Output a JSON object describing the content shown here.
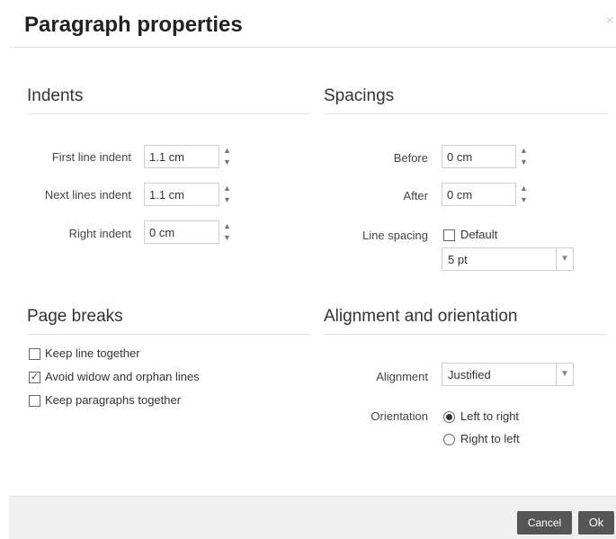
{
  "dialog": {
    "title": "Paragraph properties",
    "close_glyph": "×"
  },
  "indents": {
    "heading": "Indents",
    "first_line": {
      "label": "First line indent",
      "value": "1.1 cm"
    },
    "next_lines": {
      "label": "Next lines indent",
      "value": "1.1 cm"
    },
    "right": {
      "label": "Right indent",
      "value": "0 cm"
    }
  },
  "spacings": {
    "heading": "Spacings",
    "before": {
      "label": "Before",
      "value": "0 cm"
    },
    "after": {
      "label": "After",
      "value": "0 cm"
    },
    "line_spacing": {
      "label": "Line spacing",
      "default_label": "Default",
      "default_checked": false,
      "value": "5 pt"
    }
  },
  "page_breaks": {
    "heading": "Page breaks",
    "options": [
      {
        "label": "Keep line together",
        "checked": false
      },
      {
        "label": "Avoid widow and orphan lines",
        "checked": true
      },
      {
        "label": "Keep paragraphs together",
        "checked": false
      }
    ]
  },
  "alignment": {
    "heading": "Alignment and orientation",
    "alignment_label": "Alignment",
    "alignment_value": "Justified",
    "orientation_label": "Orientation",
    "orientations": [
      {
        "label": "Left to right",
        "selected": true
      },
      {
        "label": "Right to left",
        "selected": false
      }
    ]
  },
  "footer": {
    "cancel_label": "Cancel",
    "ok_label": "Ok"
  }
}
